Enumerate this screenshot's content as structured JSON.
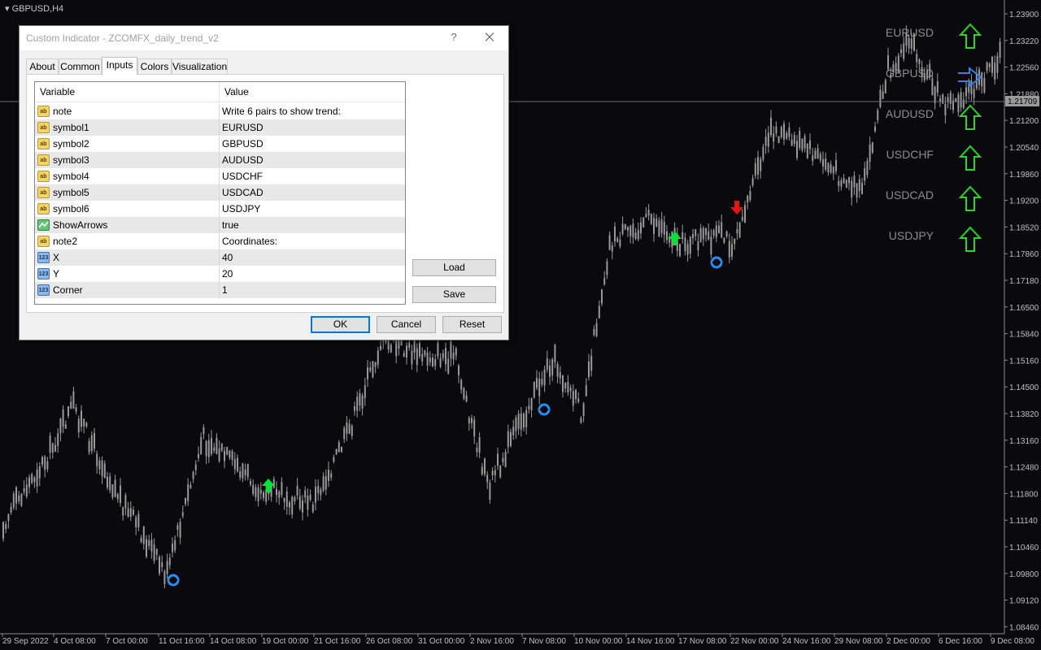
{
  "chart": {
    "symbol_label": "GBPUSD,H4",
    "price_axis_labels": [
      "1.23900",
      "1.23220",
      "1.22560",
      "1.21880",
      "1.21200",
      "1.20540",
      "1.19860",
      "1.19200",
      "1.18520",
      "1.17860",
      "1.17180",
      "1.16500",
      "1.15840",
      "1.15160",
      "1.14500",
      "1.13820",
      "1.13160",
      "1.12480",
      "1.11800",
      "1.11140",
      "1.10460",
      "1.09800",
      "1.09120",
      "1.08460"
    ],
    "current_price": "1.21709",
    "time_axis_labels": [
      "29 Sep 2022",
      "4 Oct 08:00",
      "7 Oct 00:00",
      "11 Oct 16:00",
      "14 Oct 08:00",
      "19 Oct 00:00",
      "21 Oct 16:00",
      "26 Oct 08:00",
      "31 Oct 00:00",
      "2 Nov 16:00",
      "7 Nov 08:00",
      "10 Nov 00:00",
      "14 Nov 16:00",
      "17 Nov 08:00",
      "22 Nov 00:00",
      "24 Nov 16:00",
      "29 Nov 08:00",
      "2 Dec 00:00",
      "6 Dec 16:00",
      "9 Dec 08:00"
    ],
    "colors": {
      "background": "#0a0a0e",
      "candle": "#9a9a9a",
      "axis_text": "#c0c0c0",
      "up_arrow": "#00e636",
      "down_arrow": "#e61414",
      "blue_marker": "#2a8cf0",
      "trend_up": "#2ad62a",
      "trend_flat": "#3a7ee6"
    }
  },
  "trend_panel": [
    {
      "pair": "EURUSD",
      "direction": "up"
    },
    {
      "pair": "GBPUSD",
      "direction": "right"
    },
    {
      "pair": "AUDUSD",
      "direction": "up"
    },
    {
      "pair": "USDCHF",
      "direction": "up"
    },
    {
      "pair": "USDCAD",
      "direction": "up"
    },
    {
      "pair": "USDJPY",
      "direction": "up"
    }
  ],
  "dialog": {
    "title": "Custom Indicator - ZCOMFX_daily_trend_v2",
    "help": "?",
    "tabs": [
      "About",
      "Common",
      "Inputs",
      "Colors",
      "Visualization"
    ],
    "active_tab": "Inputs",
    "columns": {
      "variable": "Variable",
      "value": "Value"
    },
    "inputs": [
      {
        "icon": "ab",
        "name": "note",
        "value": "Write 6 pairs to show trend:"
      },
      {
        "icon": "ab",
        "name": "symbol1",
        "value": "EURUSD"
      },
      {
        "icon": "ab",
        "name": "symbol2",
        "value": "GBPUSD"
      },
      {
        "icon": "ab",
        "name": "symbol3",
        "value": "AUDUSD"
      },
      {
        "icon": "ab",
        "name": "symbol4",
        "value": "USDCHF"
      },
      {
        "icon": "ab",
        "name": "symbol5",
        "value": "USDCAD"
      },
      {
        "icon": "ab",
        "name": "symbol6",
        "value": "USDJPY"
      },
      {
        "icon": "bool",
        "name": "ShowArrows",
        "value": "true"
      },
      {
        "icon": "ab",
        "name": "note2",
        "value": "Coordinates:"
      },
      {
        "icon": "num",
        "name": "X",
        "value": "40"
      },
      {
        "icon": "num",
        "name": "Y",
        "value": "20"
      },
      {
        "icon": "num",
        "name": "Corner",
        "value": "1"
      }
    ],
    "buttons": {
      "load": "Load",
      "save": "Save",
      "ok": "OK",
      "cancel": "Cancel",
      "reset": "Reset"
    }
  }
}
